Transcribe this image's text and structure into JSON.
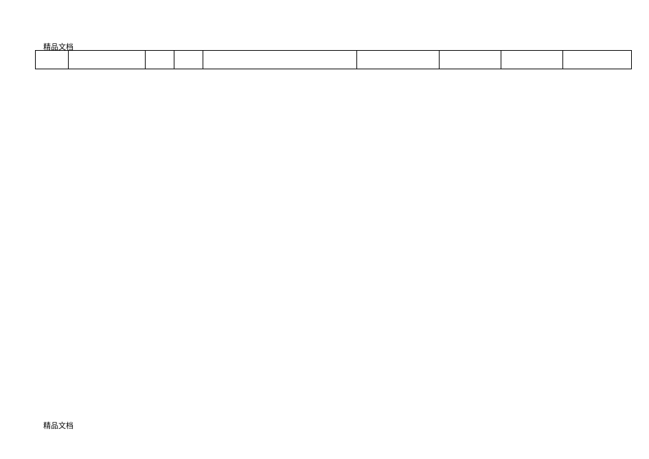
{
  "header": {
    "label": "精品文档"
  },
  "footer": {
    "label": "精品文档"
  },
  "table": {
    "rows": [
      {
        "cells": [
          "",
          "",
          "",
          "",
          "",
          "",
          "",
          "",
          ""
        ]
      }
    ]
  }
}
